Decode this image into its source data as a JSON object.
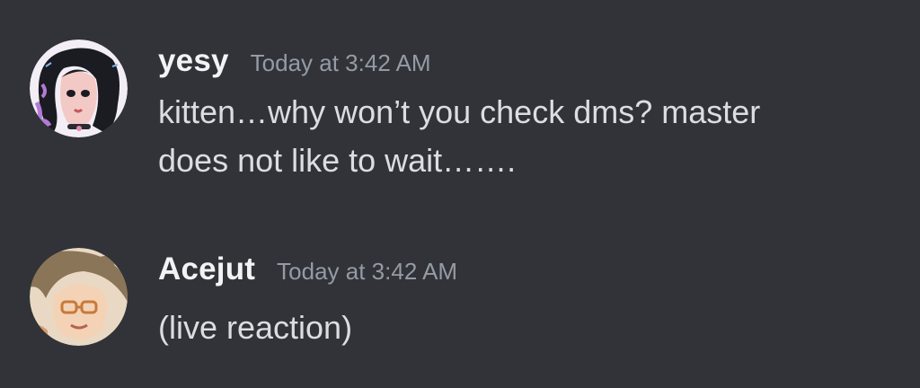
{
  "messages": [
    {
      "author": "yesy",
      "timestamp": "Today at 3:42 AM",
      "content_lines": [
        "kitten…why won’t you check dms? master",
        "does not like to wait……."
      ]
    },
    {
      "author": "Acejut",
      "timestamp": "Today at 3:42 AM",
      "content_lines": [
        "(live reaction)"
      ]
    }
  ],
  "colors": {
    "background": "#313338",
    "username": "#f2f3f5",
    "timestamp": "#949ba4",
    "message_text": "#dbdee1"
  }
}
